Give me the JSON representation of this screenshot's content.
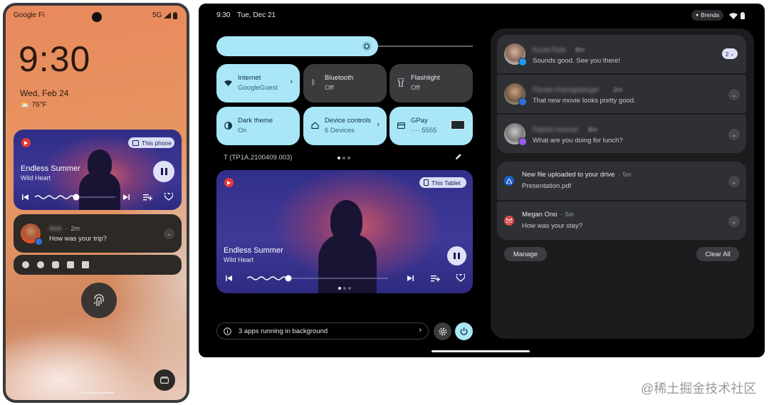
{
  "phone": {
    "carrier": "Google Fi",
    "network": "5G",
    "clock": "9:30",
    "date": "Wed, Feb 24",
    "temperature": "76°F",
    "media": {
      "output_label": "This phone",
      "title": "Endless Summer",
      "artist": "Wild Heart"
    },
    "notification": {
      "sender": "Alok",
      "time": "2m",
      "message": "How was your trip?"
    },
    "app_icons": [
      "person-icon",
      "facebook-icon",
      "youtube-icon",
      "drive-icon",
      "calendar-icon"
    ]
  },
  "tablet": {
    "time": "9:30",
    "date": "Tue, Dec 21",
    "user_chip": "Brenda",
    "tiles": [
      {
        "title": "Internet",
        "subtitle": "GoogleGuest",
        "state": "on"
      },
      {
        "title": "Bluetooth",
        "subtitle": "Off",
        "state": "off"
      },
      {
        "title": "Flashlight",
        "subtitle": "Off",
        "state": "off"
      },
      {
        "title": "Dark theme",
        "subtitle": "On",
        "state": "on"
      },
      {
        "title": "Device controls",
        "subtitle": "6 Devices",
        "state": "on"
      },
      {
        "title": "GPay",
        "subtitle": "···· 5555",
        "state": "on"
      }
    ],
    "build": "T (TP1A.2100409.003)",
    "media": {
      "output_label": "This Tablet",
      "title": "Endless Summer",
      "artist": "Wild Heart"
    },
    "background_apps": "3 apps running in background",
    "conversations": [
      {
        "name": "Eunie Park",
        "time": "8m",
        "message": "Sounds good. See you there!",
        "count": "2"
      },
      {
        "name": "Florian Koenigsberger",
        "time": "2m",
        "message": "That new movie looks pretty good."
      },
      {
        "name": "Patrick Hosmer",
        "time": "8m",
        "message": "What are you doing for lunch?"
      }
    ],
    "alerts": [
      {
        "title": "New file uploaded to your drive",
        "time": "5m",
        "message": "Presentation.pdf"
      },
      {
        "title": "Megan Ono",
        "time": "5m",
        "message": "How was your stay?"
      }
    ],
    "manage_label": "Manage",
    "clear_all_label": "Clear All"
  },
  "watermark": "@稀土掘金技术社区",
  "colors": {
    "tile_active": "#a8e6f8",
    "tile_inactive": "#3a3b3d",
    "panel": "#1c1c1e",
    "phone_wallpaper": "#e8895d",
    "media_card": "#32308a"
  }
}
